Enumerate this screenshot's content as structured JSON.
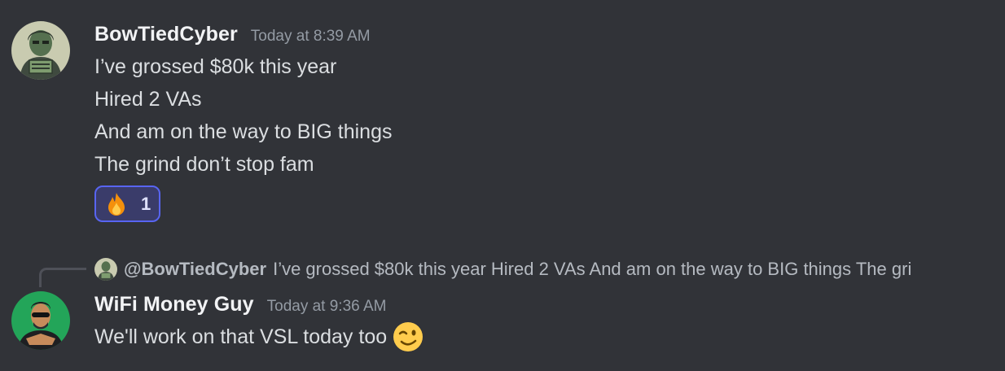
{
  "messages": [
    {
      "username": "BowTiedCyber",
      "timestamp": "Today at 8:39 AM",
      "lines": [
        "I’ve grossed $80k this year",
        "Hired 2 VAs",
        "And am on the way to BIG things",
        "The grind don’t stop fam"
      ],
      "reaction": {
        "emoji": "fire-icon",
        "count": "1"
      }
    },
    {
      "reply": {
        "username": "@BowTiedCyber",
        "text": "I’ve grossed $80k this year Hired 2 VAs And am on the way to BIG things The gri"
      },
      "username": "WiFi Money Guy",
      "timestamp": "Today at 9:36 AM",
      "text": "We'll work on that VSL today too",
      "emoji": "winking-face-icon"
    }
  ],
  "colors": {
    "background": "#313338",
    "text": "#dbdee1",
    "username": "#f2f3f5",
    "timestamp": "#949ba4",
    "reaction_border": "#5865f2",
    "reaction_bg": "#3a3c6a"
  }
}
